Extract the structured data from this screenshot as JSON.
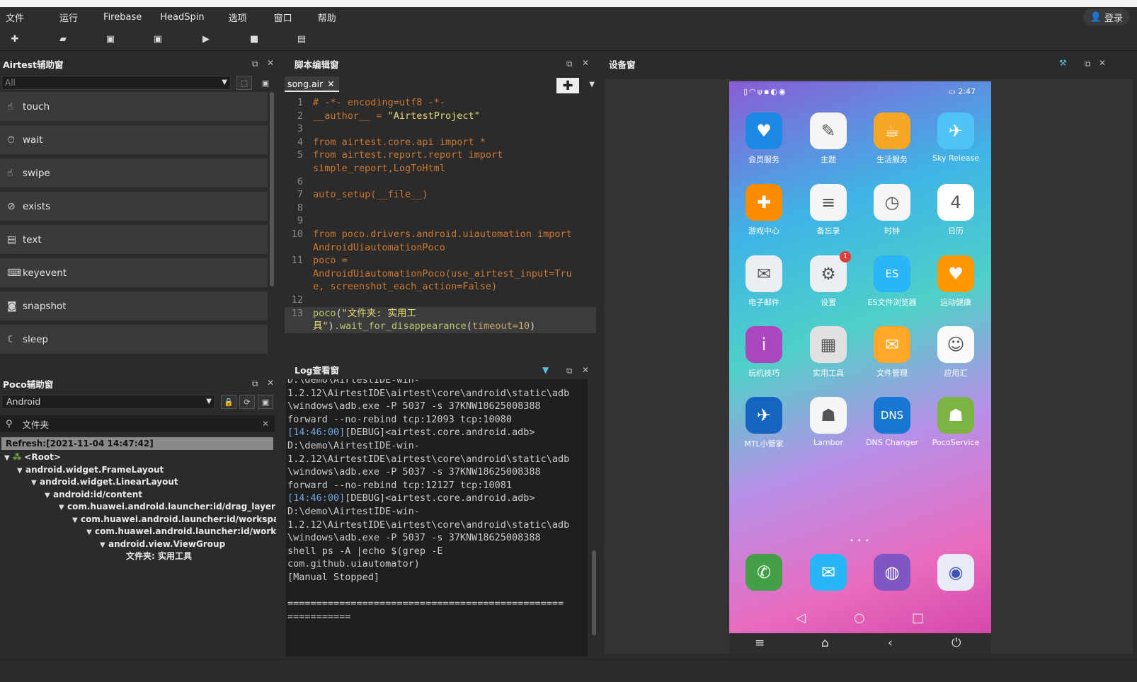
{
  "menu": [
    "文件",
    "运行",
    "Firebase",
    "HeadSpin",
    "选项",
    "窗口",
    "帮助"
  ],
  "login_label": "登录",
  "toolbar_icons": [
    "add-icon",
    "open-folder-icon",
    "save-icon",
    "save-as-icon",
    "play-icon",
    "stop-icon",
    "report-icon"
  ],
  "airtest": {
    "title": "Airtest辅助窗",
    "filter_value": "All",
    "commands": [
      {
        "label": "touch",
        "icon": "☝"
      },
      {
        "label": "wait",
        "icon": "⏱"
      },
      {
        "label": "swipe",
        "icon": "☝"
      },
      {
        "label": "exists",
        "icon": "⊘"
      },
      {
        "label": "text",
        "icon": "▤"
      },
      {
        "label": "keyevent",
        "icon": "⌨"
      },
      {
        "label": "snapshot",
        "icon": "◙"
      },
      {
        "label": "sleep",
        "icon": "☾"
      }
    ]
  },
  "poco": {
    "title": "Poco辅助窗",
    "driver": "Android",
    "search_value": "文件夹",
    "refresh": "Refresh:[2021-11-04 14:47:42]",
    "tree": [
      {
        "label": "<Root>",
        "depth": 0,
        "arrow": "▼"
      },
      {
        "label": "android.widget.FrameLayout",
        "depth": 1,
        "arrow": "▼"
      },
      {
        "label": "android.widget.LinearLayout",
        "depth": 2,
        "arrow": "▼"
      },
      {
        "label": "android:id/content",
        "depth": 3,
        "arrow": "▼"
      },
      {
        "label": "com.huawei.android.launcher:id/drag_layer",
        "depth": 4,
        "arrow": "▼"
      },
      {
        "label": "com.huawei.android.launcher:id/workspace",
        "depth": 5,
        "arrow": "▼"
      },
      {
        "label": "com.huawei.android.launcher:id/works...",
        "depth": 6,
        "arrow": "▼"
      },
      {
        "label": "android.view.ViewGroup",
        "depth": 7,
        "arrow": "▼"
      },
      {
        "label": "文件夹: 实用工具",
        "depth": 8,
        "arrow": ""
      }
    ]
  },
  "script": {
    "title": "脚本编辑窗",
    "tab": "song.air"
  },
  "log": {
    "title": "Log查看窗",
    "lines": [
      {
        "ts": "",
        "text": "D:\\demo\\AirtestIDE-win-"
      },
      {
        "ts": "",
        "text": "1.2.12\\AirtestIDE\\airtest\\core\\android\\static\\adb"
      },
      {
        "ts": "",
        "text": "\\windows\\adb.exe -P 5037 -s 37KNW18625008388"
      },
      {
        "ts": "",
        "text": "forward --no-rebind tcp:12093 tcp:10080"
      },
      {
        "ts": "[14:46:00]",
        "text": "[DEBUG]<airtest.core.android.adb>"
      },
      {
        "ts": "",
        "text": "D:\\demo\\AirtestIDE-win-"
      },
      {
        "ts": "",
        "text": "1.2.12\\AirtestIDE\\airtest\\core\\android\\static\\adb"
      },
      {
        "ts": "",
        "text": "\\windows\\adb.exe -P 5037 -s 37KNW18625008388"
      },
      {
        "ts": "",
        "text": "forward --no-rebind tcp:12127 tcp:10081"
      },
      {
        "ts": "[14:46:00]",
        "text": "[DEBUG]<airtest.core.android.adb>"
      },
      {
        "ts": "",
        "text": "D:\\demo\\AirtestIDE-win-"
      },
      {
        "ts": "",
        "text": "1.2.12\\AirtestIDE\\airtest\\core\\android\\static\\adb"
      },
      {
        "ts": "",
        "text": "\\windows\\adb.exe -P 5037 -s 37KNW18625008388"
      },
      {
        "ts": "",
        "text": "shell ps -A |echo $(grep -E"
      },
      {
        "ts": "",
        "text": "com.github.uiautomator)"
      },
      {
        "ts": "",
        "text": "[Manual Stopped]"
      },
      {
        "ts": "",
        "text": ""
      },
      {
        "ts": "",
        "text": "================================================"
      },
      {
        "ts": "",
        "text": "==========="
      }
    ]
  },
  "device": {
    "title": "设备窗",
    "status_time": "2:47",
    "apps": [
      {
        "label": "会员服务",
        "color": "#1e88e5",
        "glyph": "♥"
      },
      {
        "label": "主题",
        "color": "#f5f5f5",
        "glyph": "✎"
      },
      {
        "label": "生活服务",
        "color": "#f5a623",
        "glyph": "☕"
      },
      {
        "label": "Sky Release",
        "color": "#4fc3f7",
        "glyph": "✈"
      },
      {
        "label": "游戏中心",
        "color": "#fb8c00",
        "glyph": "✚"
      },
      {
        "label": "备忘录",
        "color": "#f5f5f5",
        "glyph": "≡"
      },
      {
        "label": "时钟",
        "color": "#f5f5f5",
        "glyph": "◷"
      },
      {
        "label": "日历",
        "color": "#ffffff",
        "glyph": "4"
      },
      {
        "label": "电子邮件",
        "color": "#eceff1",
        "glyph": "✉"
      },
      {
        "label": "设置",
        "color": "#eceff1",
        "glyph": "⚙"
      },
      {
        "label": "ES文件浏览器",
        "color": "#29b6f6",
        "glyph": "ES"
      },
      {
        "label": "运动健康",
        "color": "#ff9800",
        "glyph": "♥"
      },
      {
        "label": "玩机技巧",
        "color": "#ab47bc",
        "glyph": "i"
      },
      {
        "label": "实用工具",
        "color": "#e0e0e0",
        "glyph": "▦"
      },
      {
        "label": "文件管理",
        "color": "#ffa726",
        "glyph": "✉"
      },
      {
        "label": "应用汇",
        "color": "#fafafa",
        "glyph": "☺"
      },
      {
        "label": "MTL小管家",
        "color": "#1565c0",
        "glyph": "✈"
      },
      {
        "label": "Lambor",
        "color": "#f5f5f5",
        "glyph": "☗"
      },
      {
        "label": "DNS Changer",
        "color": "#1976d2",
        "glyph": "DNS"
      },
      {
        "label": "PocoService",
        "color": "#7cb342",
        "glyph": "☗"
      }
    ],
    "settings_badge": "1",
    "dock": [
      {
        "label": "phone",
        "color": "#43a047",
        "glyph": "✆"
      },
      {
        "label": "messages",
        "color": "#29b6f6",
        "glyph": "✉"
      },
      {
        "label": "browser",
        "color": "#7e57c2",
        "glyph": "◍"
      },
      {
        "label": "camera",
        "color": "#e8eaf6",
        "glyph": "◉"
      }
    ]
  }
}
